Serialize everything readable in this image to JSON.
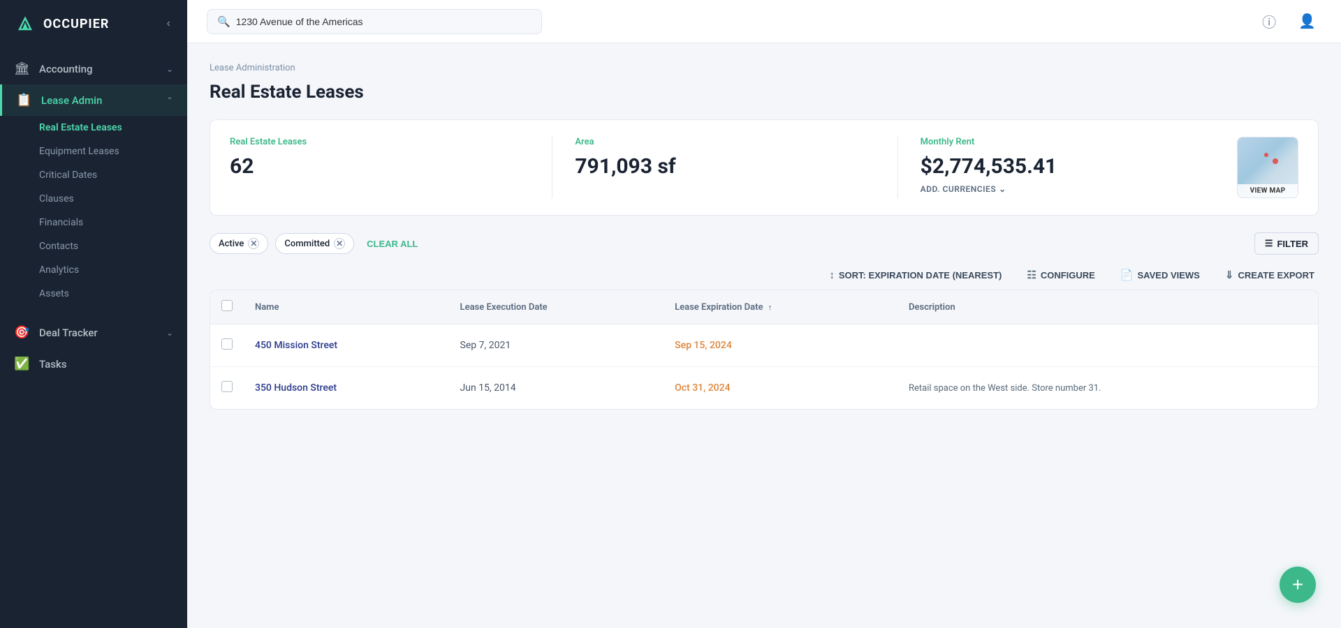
{
  "app": {
    "name": "OCCUPIER"
  },
  "topbar": {
    "search_placeholder": "1230 Avenue of the Americas",
    "search_value": "1230 Avenue of the Americas"
  },
  "sidebar": {
    "collapse_label": "Collapse",
    "nav": [
      {
        "id": "accounting",
        "label": "Accounting",
        "icon": "🏛",
        "hasChevron": true,
        "active": false
      },
      {
        "id": "lease-admin",
        "label": "Lease Admin",
        "icon": "📋",
        "hasChevron": true,
        "active": true
      }
    ],
    "subnav": [
      {
        "id": "real-estate-leases",
        "label": "Real Estate Leases",
        "active": true
      },
      {
        "id": "equipment-leases",
        "label": "Equipment Leases",
        "active": false
      },
      {
        "id": "critical-dates",
        "label": "Critical Dates",
        "active": false
      },
      {
        "id": "clauses",
        "label": "Clauses",
        "active": false
      },
      {
        "id": "financials",
        "label": "Financials",
        "active": false
      },
      {
        "id": "contacts",
        "label": "Contacts",
        "active": false
      },
      {
        "id": "analytics",
        "label": "Analytics",
        "active": false
      },
      {
        "id": "assets",
        "label": "Assets",
        "active": false
      }
    ],
    "bottom_nav": [
      {
        "id": "deal-tracker",
        "label": "Deal Tracker",
        "icon": "🎯",
        "hasChevron": true
      },
      {
        "id": "tasks",
        "label": "Tasks",
        "icon": "✅",
        "hasChevron": false
      }
    ]
  },
  "page": {
    "breadcrumb": "Lease Administration",
    "title": "Real Estate Leases"
  },
  "stats": {
    "leases_label": "Real Estate Leases",
    "leases_value": "62",
    "area_label": "Area",
    "area_value": "791,093 sf",
    "monthly_rent_label": "Monthly Rent",
    "monthly_rent_value": "$2,774,535.41",
    "add_currencies_label": "ADD. CURRENCIES",
    "map_label": "VIEW MAP"
  },
  "filters": {
    "chips": [
      {
        "id": "active",
        "label": "Active"
      },
      {
        "id": "committed",
        "label": "Committed"
      }
    ],
    "clear_all_label": "CLEAR ALL",
    "filter_btn_label": "FILTER"
  },
  "table_actions": {
    "sort_label": "SORT: EXPIRATION DATE (NEAREST)",
    "configure_label": "CONFIGURE",
    "saved_views_label": "SAVED VIEWS",
    "create_export_label": "CREATE EXPORT"
  },
  "table": {
    "columns": [
      {
        "id": "name",
        "label": "Name",
        "sortable": false
      },
      {
        "id": "execution_date",
        "label": "Lease Execution Date",
        "sortable": false
      },
      {
        "id": "expiration_date",
        "label": "Lease Expiration Date",
        "sortable": true
      },
      {
        "id": "description",
        "label": "Description",
        "sortable": false
      }
    ],
    "rows": [
      {
        "name": "450 Mission Street",
        "execution_date": "Sep 7, 2021",
        "expiration_date": "Sep 15, 2024",
        "expiration_warn": true,
        "description": ""
      },
      {
        "name": "350 Hudson Street",
        "execution_date": "Jun 15, 2014",
        "expiration_date": "Oct 31, 2024",
        "expiration_warn": true,
        "description": "Retail space on the West side. Store number 31."
      }
    ]
  }
}
